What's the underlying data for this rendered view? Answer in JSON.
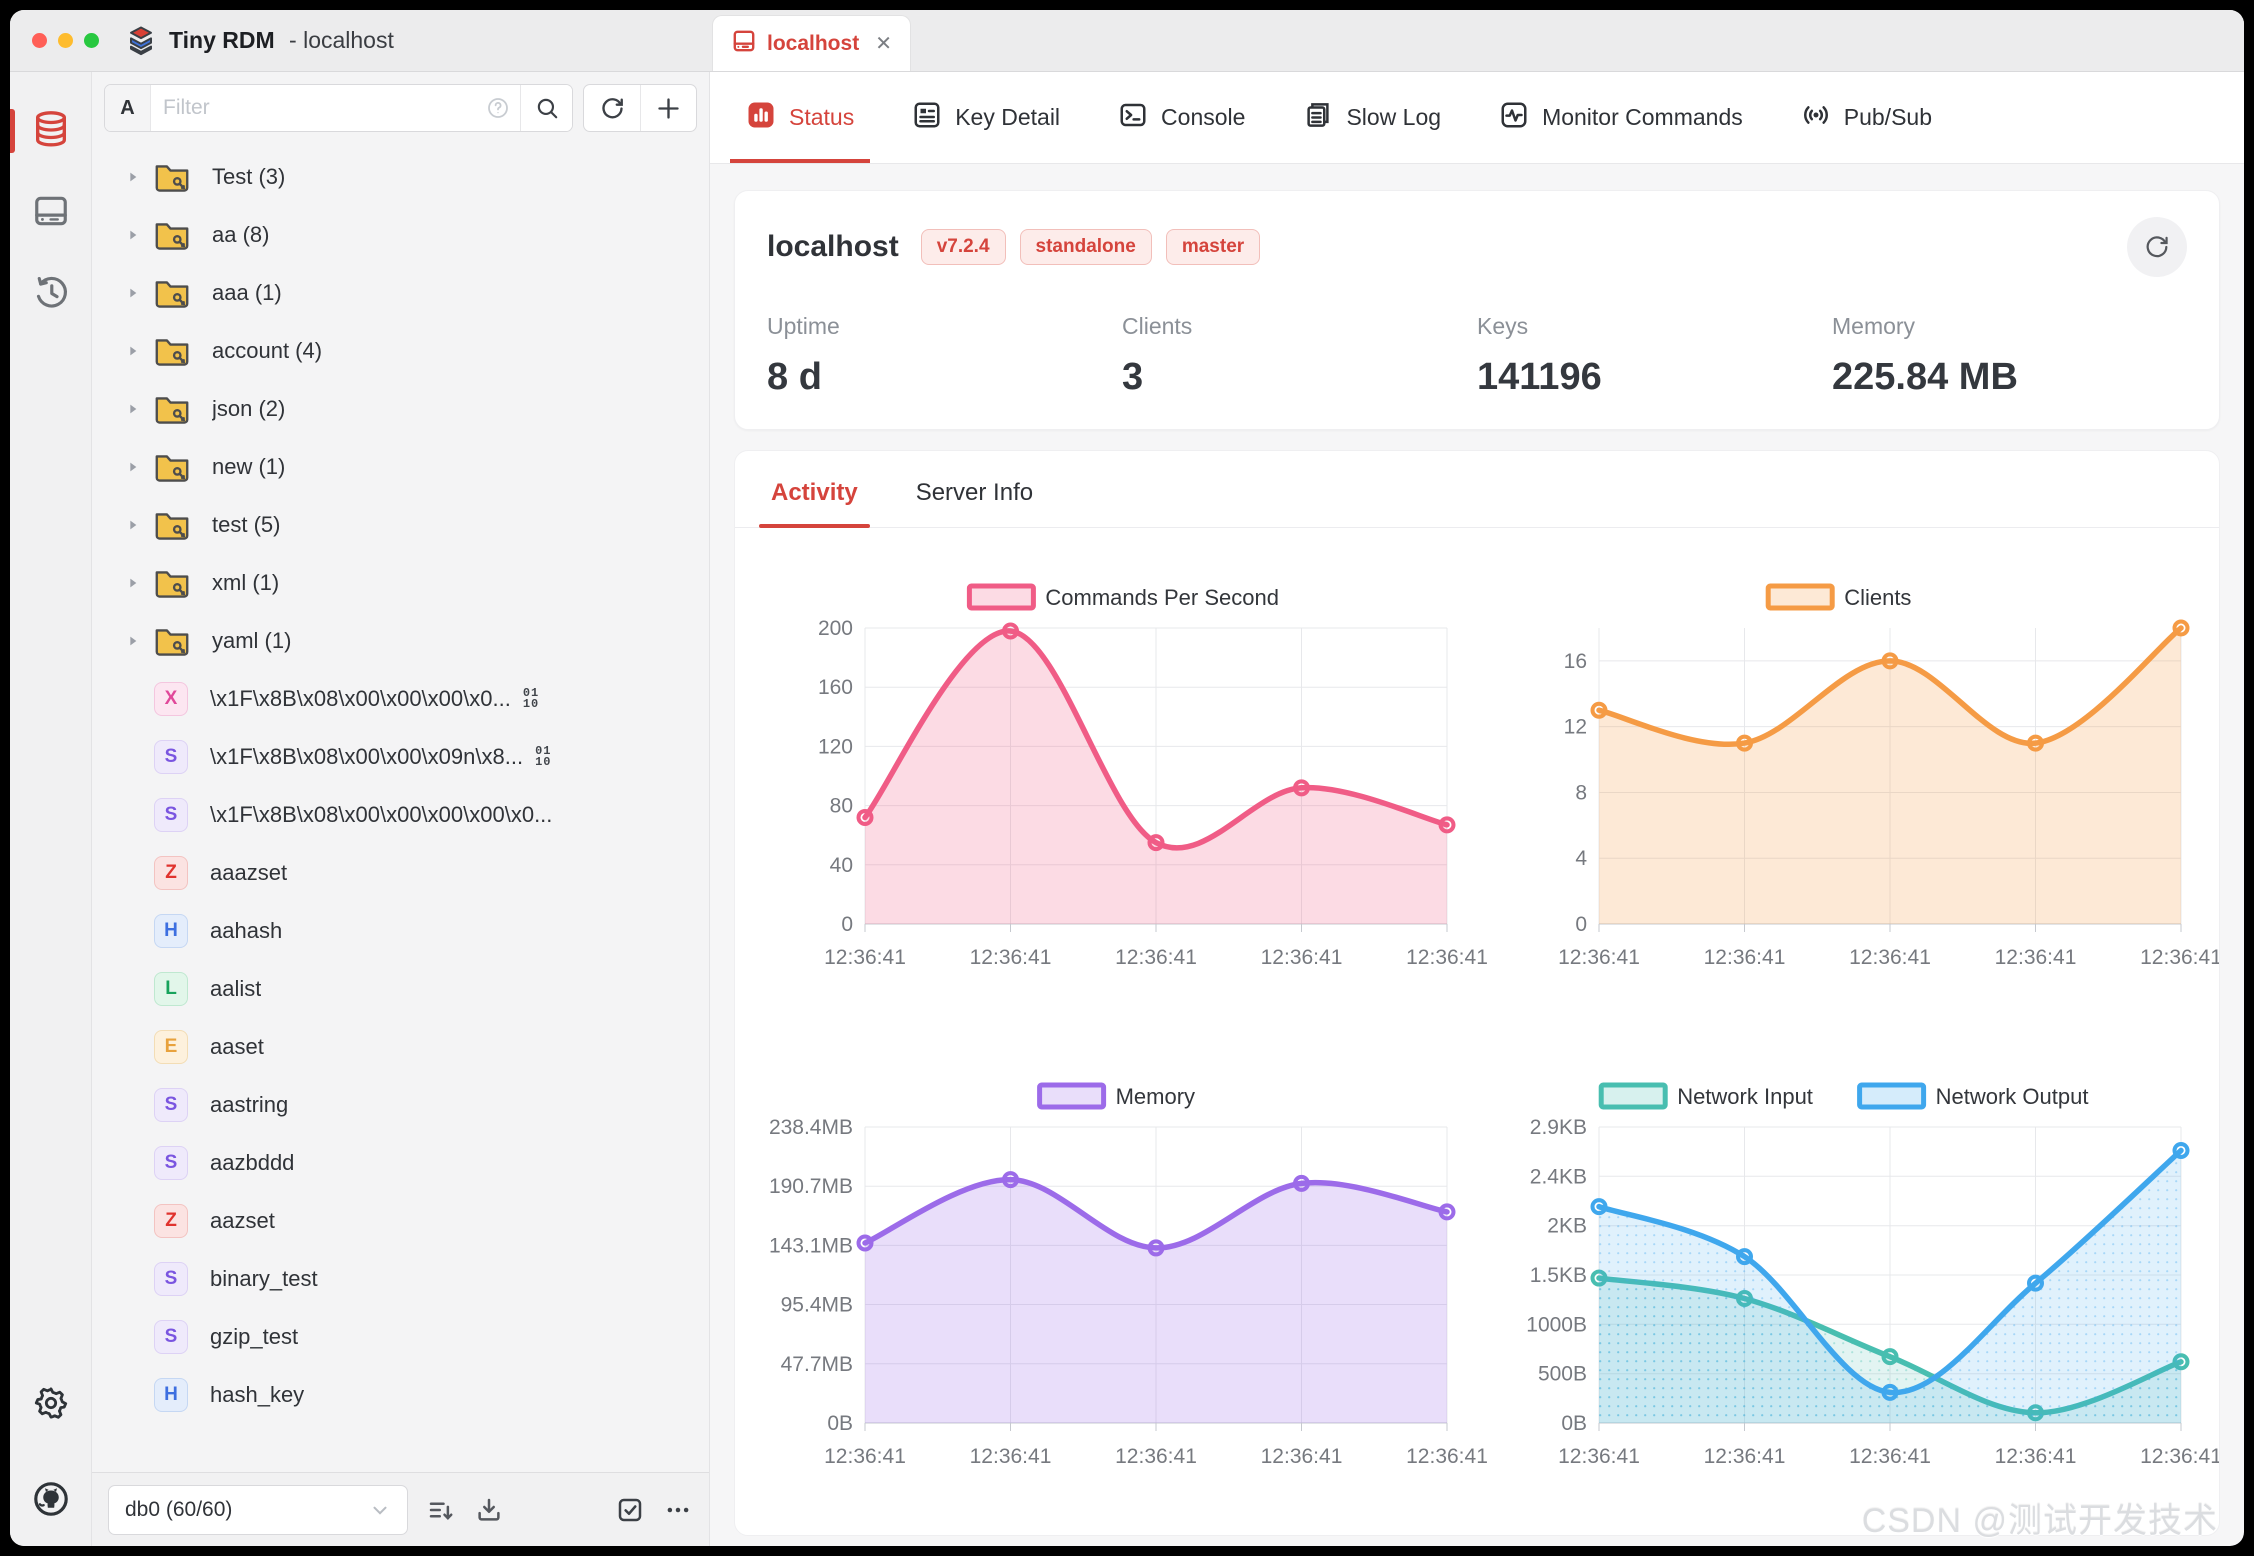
{
  "window": {
    "app_name": "Tiny RDM",
    "connection": "- localhost"
  },
  "titlebar_buttons": [
    "close",
    "minimize",
    "zoom"
  ],
  "tabbar": {
    "tab_label": "localhost",
    "close_icon": "✕"
  },
  "rail": {
    "items": [
      {
        "icon": "database-icon",
        "active": true
      },
      {
        "icon": "server-icon",
        "active": false
      },
      {
        "icon": "history-icon",
        "active": false
      }
    ],
    "bottom": [
      {
        "icon": "settings-icon"
      },
      {
        "icon": "github-icon"
      }
    ]
  },
  "browser": {
    "filter": {
      "mode_label": "A",
      "placeholder": "Filter"
    },
    "folders": [
      {
        "name": "Test",
        "count": 3,
        "display": "Test (3)"
      },
      {
        "name": "aa",
        "count": 8,
        "display": "aa (8)"
      },
      {
        "name": "aaa",
        "count": 1,
        "display": "aaa (1)"
      },
      {
        "name": "account",
        "count": 4,
        "display": "account (4)"
      },
      {
        "name": "json",
        "count": 2,
        "display": "json (2)"
      },
      {
        "name": "new",
        "count": 1,
        "display": "new (1)"
      },
      {
        "name": "test",
        "count": 5,
        "display": "test (5)"
      },
      {
        "name": "xml",
        "count": 1,
        "display": "xml (1)"
      },
      {
        "name": "yaml",
        "count": 1,
        "display": "yaml (1)"
      }
    ],
    "keys": [
      {
        "type": "X",
        "name": "\\x1F\\x8B\\x08\\x00\\x00\\x00\\x0...",
        "binary": true
      },
      {
        "type": "S",
        "name": "\\x1F\\x8B\\x08\\x00\\x00\\x09n\\x8...",
        "binary": true
      },
      {
        "type": "S",
        "name": "\\x1F\\x8B\\x08\\x00\\x00\\x00\\x00\\x0...",
        "binary": false
      },
      {
        "type": "Z",
        "name": "aaazset",
        "binary": false
      },
      {
        "type": "H",
        "name": "aahash",
        "binary": false
      },
      {
        "type": "L",
        "name": "aalist",
        "binary": false
      },
      {
        "type": "E",
        "name": "aaset",
        "binary": false
      },
      {
        "type": "S",
        "name": "aastring",
        "binary": false
      },
      {
        "type": "S",
        "name": "aazbddd",
        "binary": false
      },
      {
        "type": "Z",
        "name": "aazset",
        "binary": false
      },
      {
        "type": "S",
        "name": "binary_test",
        "binary": false
      },
      {
        "type": "S",
        "name": "gzip_test",
        "binary": false
      },
      {
        "type": "H",
        "name": "hash_key",
        "binary": false
      }
    ],
    "db_selected": "db0 (60/60)"
  },
  "key_type_colors": {
    "X": {
      "fg": "#e0489a",
      "bg": "#fce6f1",
      "border": "#f4c6df"
    },
    "S": {
      "fg": "#7a55e0",
      "bg": "#efeafb",
      "border": "#ddd2f5"
    },
    "Z": {
      "fg": "#e0332e",
      "bg": "#fbe3e2",
      "border": "#f3c3c1"
    },
    "H": {
      "fg": "#3d6fe0",
      "bg": "#e4edfb",
      "border": "#c5d7f3"
    },
    "L": {
      "fg": "#17a35c",
      "bg": "#e2f6ea",
      "border": "#bfe8d0"
    },
    "E": {
      "fg": "#e8a23d",
      "bg": "#fdf1dd",
      "border": "#f3ddb5"
    }
  },
  "nav": {
    "tabs": [
      {
        "label": "Status",
        "icon": "status-icon",
        "active": true
      },
      {
        "label": "Key Detail",
        "icon": "key-detail-icon",
        "active": false
      },
      {
        "label": "Console",
        "icon": "console-icon",
        "active": false
      },
      {
        "label": "Slow Log",
        "icon": "slow-log-icon",
        "active": false
      },
      {
        "label": "Monitor Commands",
        "icon": "monitor-commands-icon",
        "active": false
      },
      {
        "label": "Pub/Sub",
        "icon": "pubsub-icon",
        "active": false
      }
    ]
  },
  "server": {
    "name": "localhost",
    "badges": [
      "v7.2.4",
      "standalone",
      "master"
    ],
    "accent": "#d5443c",
    "stats": [
      {
        "label": "Uptime",
        "value": "8 d"
      },
      {
        "label": "Clients",
        "value": "3"
      },
      {
        "label": "Keys",
        "value": "141196"
      },
      {
        "label": "Memory",
        "value": "225.84 MB"
      }
    ]
  },
  "activity": {
    "tabs": [
      {
        "label": "Activity",
        "active": true
      },
      {
        "label": "Server Info",
        "active": false
      }
    ]
  },
  "chart_data": [
    {
      "type": "area",
      "key": "commands-per-second",
      "title": "Commands Per Second",
      "x_labels": [
        "12:36:41",
        "12:36:41",
        "12:36:41",
        "12:36:41",
        "12:36:41"
      ],
      "ymax": 200,
      "yticks": [
        {
          "v": 0,
          "label": "0"
        },
        {
          "v": 40,
          "label": "40"
        },
        {
          "v": 80,
          "label": "80"
        },
        {
          "v": 120,
          "label": "120"
        },
        {
          "v": 160,
          "label": "160"
        },
        {
          "v": 200,
          "label": "200"
        }
      ],
      "legend_position": "top",
      "grid": true,
      "series": [
        {
          "name": "Commands Per Second",
          "color": "#f05c86",
          "values": [
            72,
            198,
            55,
            92,
            67
          ],
          "decal": false
        }
      ]
    },
    {
      "type": "area",
      "key": "clients",
      "title": "Clients",
      "x_labels": [
        "12:36:41",
        "12:36:41",
        "12:36:41",
        "12:36:41",
        "12:36:41"
      ],
      "ymax": 18,
      "yticks": [
        {
          "v": 0,
          "label": "0"
        },
        {
          "v": 4,
          "label": "4"
        },
        {
          "v": 8,
          "label": "8"
        },
        {
          "v": 12,
          "label": "12"
        },
        {
          "v": 16,
          "label": "16"
        }
      ],
      "legend_position": "top",
      "grid": true,
      "series": [
        {
          "name": "Clients",
          "color": "#f59b45",
          "values": [
            13,
            11,
            16,
            11,
            18
          ],
          "decal": false
        }
      ]
    },
    {
      "type": "area",
      "key": "memory",
      "title": "Memory",
      "x_labels": [
        "12:36:41",
        "12:36:41",
        "12:36:41",
        "12:36:41",
        "12:36:41"
      ],
      "ymax": 238.4,
      "unit": "MB",
      "yticks": [
        {
          "v": 0,
          "label": "0B"
        },
        {
          "v": 47.7,
          "label": "47.7MB"
        },
        {
          "v": 95.4,
          "label": "95.4MB"
        },
        {
          "v": 143.1,
          "label": "143.1MB"
        },
        {
          "v": 190.7,
          "label": "190.7MB"
        },
        {
          "v": 238.4,
          "label": "238.4MB"
        }
      ],
      "legend_position": "top",
      "grid": true,
      "series": [
        {
          "name": "Memory",
          "color": "#9c6be9",
          "values": [
            145,
            196,
            141,
            193,
            170
          ],
          "decal": false
        }
      ]
    },
    {
      "type": "area",
      "key": "network",
      "title": "Network",
      "x_labels": [
        "12:36:41",
        "12:36:41",
        "12:36:41",
        "12:36:41",
        "12:36:41"
      ],
      "ymax": 2900,
      "unit": "B",
      "yticks": [
        {
          "v": 0,
          "label": "0B"
        },
        {
          "v": 483,
          "label": "500B"
        },
        {
          "v": 967,
          "label": "1000B"
        },
        {
          "v": 1450,
          "label": "1.5KB"
        },
        {
          "v": 1933,
          "label": "2KB"
        },
        {
          "v": 2417,
          "label": "2.4KB"
        },
        {
          "v": 2900,
          "label": "2.9KB"
        }
      ],
      "legend_position": "top",
      "grid": true,
      "series": [
        {
          "name": "Network Input",
          "color": "#48beb0",
          "values": [
            1420,
            1220,
            650,
            100,
            600
          ],
          "decal": true
        },
        {
          "name": "Network Output",
          "color": "#3fa7ed",
          "values": [
            2120,
            1630,
            300,
            1370,
            2670
          ],
          "decal": true
        }
      ]
    }
  ],
  "watermark": "CSDN @测试开发技术"
}
